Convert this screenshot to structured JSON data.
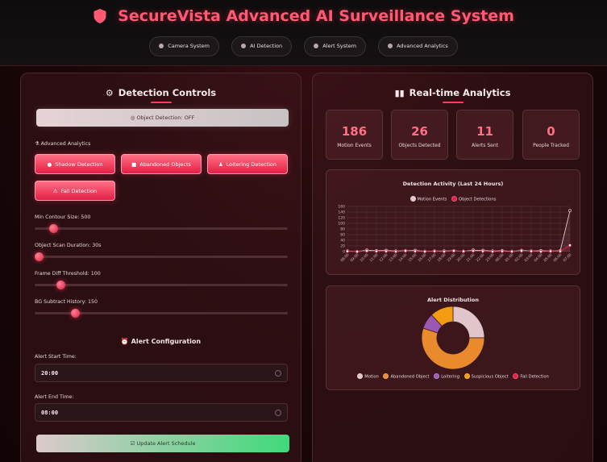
{
  "header": {
    "title": "SecureVista Advanced AI Surveillance System",
    "nav": [
      {
        "label": "Camera System"
      },
      {
        "label": "AI Detection"
      },
      {
        "label": "Alert System"
      },
      {
        "label": "Advanced Analytics"
      }
    ]
  },
  "controls": {
    "heading": "Detection Controls",
    "object_detection_label": "Object Detection: OFF",
    "advanced_label": "Advanced Analytics",
    "features": [
      {
        "label": "Shadow Detection"
      },
      {
        "label": "Abandoned Objects"
      },
      {
        "label": "Loitering Detection"
      },
      {
        "label": "Fall Detection"
      }
    ],
    "sliders": [
      {
        "label": "Min Contour Size: 500",
        "level": 0.06
      },
      {
        "label": "Object Scan Duration: 30s",
        "level": 0.0
      },
      {
        "label": "Frame Diff Threshold: 100",
        "level": 0.09
      },
      {
        "label": "BG Subtract History: 150",
        "level": 0.15
      }
    ],
    "alert_heading": "Alert Configuration",
    "start_label": "Alert Start Time:",
    "start_value": "20:00",
    "end_label": "Alert End Time:",
    "end_value": "08:00",
    "update_button": "Update Alert Schedule"
  },
  "analytics": {
    "heading": "Real-time Analytics",
    "stats": [
      {
        "value": "186",
        "label": "Motion Events"
      },
      {
        "value": "26",
        "label": "Objects Detected"
      },
      {
        "value": "11",
        "label": "Alerts Sent"
      },
      {
        "value": "0",
        "label": "People Tracked"
      }
    ]
  },
  "colors": {
    "accent": "#ff3b5c",
    "motion": "#e0c6cb",
    "abandoned": "#e98a2d",
    "loitering": "#9b59b6",
    "suspicious": "#f39c12",
    "fall": "#e41f45"
  },
  "chart_data": [
    {
      "type": "line",
      "title": "Detection Activity (Last 24 Hours)",
      "x": [
        "08:00",
        "09:00",
        "10:00",
        "11:00",
        "12:00",
        "13:00",
        "14:00",
        "15:00",
        "16:00",
        "17:00",
        "18:00",
        "19:00",
        "20:00",
        "21:00",
        "22:00",
        "23:00",
        "00:00",
        "01:00",
        "02:00",
        "03:00",
        "04:00",
        "05:00",
        "06:00",
        "07:00"
      ],
      "ylim": [
        0,
        160
      ],
      "yticks": [
        "160",
        "140",
        "120",
        "100",
        "80",
        "60",
        "40",
        "20",
        "0"
      ],
      "series": [
        {
          "name": "Motion Events",
          "values": [
            2,
            0,
            5,
            3,
            4,
            2,
            3,
            4,
            1,
            2,
            2,
            3,
            1,
            5,
            4,
            2,
            3,
            1,
            4,
            2,
            3,
            2,
            3,
            145
          ]
        },
        {
          "name": "Object Detections",
          "values": [
            1,
            0,
            2,
            1,
            1,
            0,
            2,
            1,
            0,
            1,
            0,
            2,
            1,
            2,
            1,
            0,
            1,
            0,
            2,
            1,
            0,
            1,
            1,
            22
          ]
        }
      ],
      "grid": true,
      "legend": "top"
    },
    {
      "type": "pie",
      "title": "Alert Distribution",
      "categories": [
        "Motion",
        "Abandoned Object",
        "Loitering",
        "Suspicious Object",
        "Fall Detection"
      ],
      "values": [
        25,
        55,
        8,
        12,
        0
      ],
      "legend": "bottom"
    }
  ]
}
